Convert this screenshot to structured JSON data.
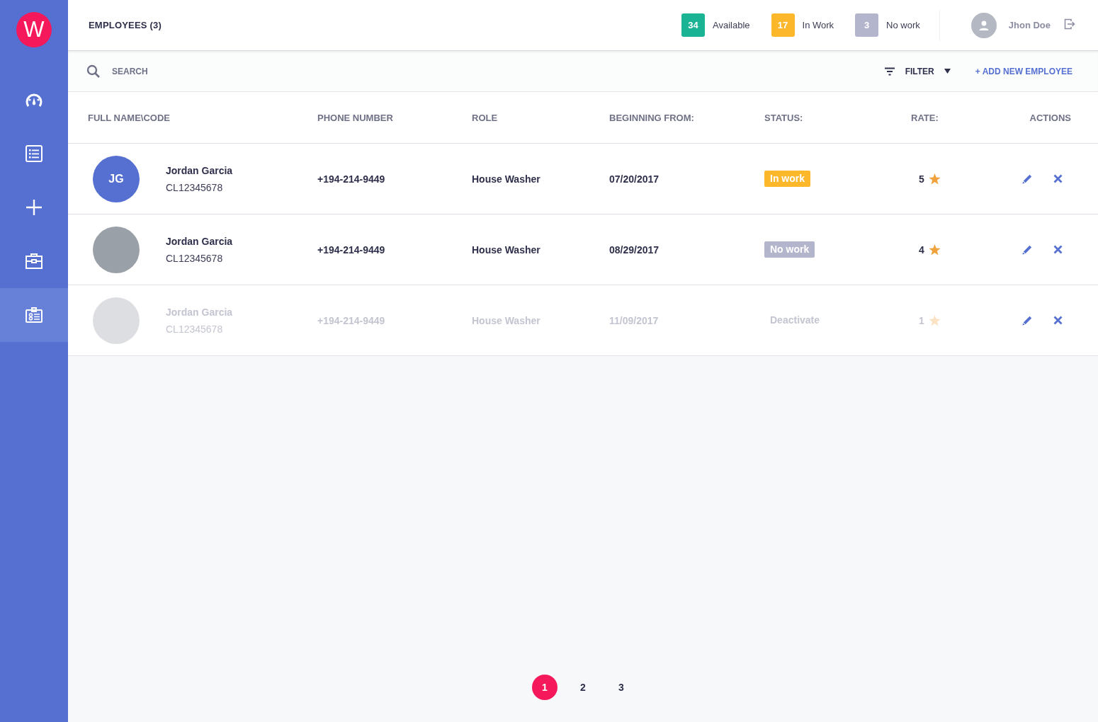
{
  "sidebar": {
    "logo": "W",
    "items": [
      {
        "selected": false
      },
      {
        "selected": false
      },
      {
        "selected": false
      },
      {
        "selected": false
      },
      {
        "selected": true
      }
    ]
  },
  "header": {
    "title": "EMPLOYEES (3)",
    "counters": [
      {
        "count": "34",
        "label": "Available",
        "color": "#1ab394"
      },
      {
        "count": "17",
        "label": "In Work",
        "color": "#fdb72b"
      },
      {
        "count": "3",
        "label": "No work",
        "color": "#b3b5cc"
      }
    ],
    "user": "Jhon Doe"
  },
  "toolbar": {
    "search_placeholder": "SEARCH",
    "filter": "FILTER",
    "add": "+ ADD NEW EMPLOYEE"
  },
  "table": {
    "columns": [
      "FULL NAME\\CODE",
      "PHONE NUMBER",
      "ROLE",
      "BEGINNING FROM:",
      "STATUS:",
      "RATE:",
      "ACTIONS"
    ],
    "rows": [
      {
        "avatar": {
          "kind": "initials",
          "text": "JG"
        },
        "name": "Jordan Garcia",
        "code": "CL12345678",
        "phone": "+194-214-9449",
        "role": "House Washer",
        "date": "07/20/2017",
        "status": {
          "kind": "in_work",
          "text": "In work"
        },
        "rate": "5",
        "active": true
      },
      {
        "avatar": {
          "kind": "photo"
        },
        "name": "Jordan Garcia",
        "code": "CL12345678",
        "phone": "+194-214-9449",
        "role": "House Washer",
        "date": "08/29/2017",
        "status": {
          "kind": "no_work",
          "text": "No work"
        },
        "rate": "4",
        "active": true
      },
      {
        "avatar": {
          "kind": "photo"
        },
        "name": "Jordan Garcia",
        "code": "CL12345678",
        "phone": "+194-214-9449",
        "role": "House Washer",
        "date": "11/09/2017",
        "status": {
          "kind": "plain",
          "text": "Deactivate"
        },
        "rate": "1",
        "active": false
      }
    ]
  },
  "pagination": [
    {
      "label": "1",
      "selected": true
    },
    {
      "label": "2",
      "selected": false
    },
    {
      "label": "3",
      "selected": false
    }
  ]
}
